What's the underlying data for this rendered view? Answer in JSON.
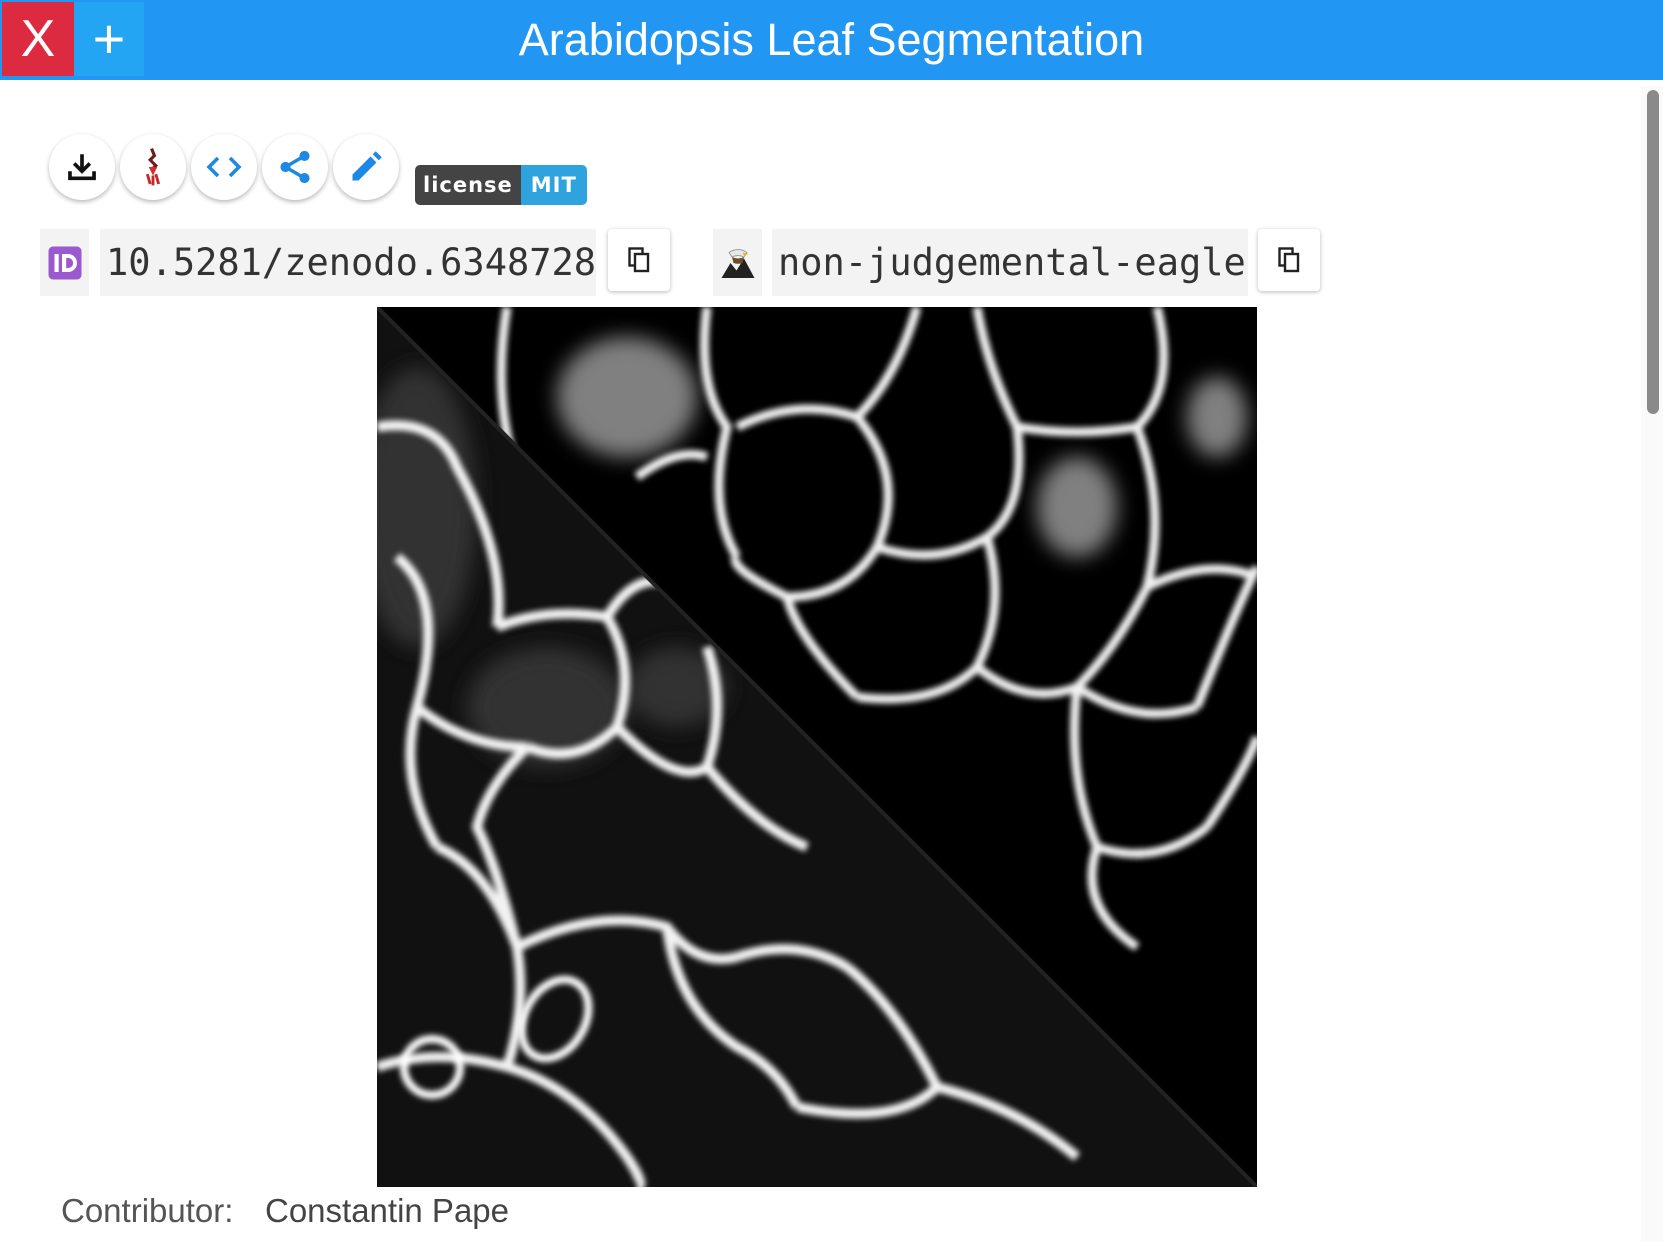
{
  "window": {
    "title": "Arabidopsis Leaf Segmentation",
    "close_label": "X",
    "add_label": "+"
  },
  "toolbar": {
    "buttons": [
      {
        "name": "download",
        "icon": "download-icon"
      },
      {
        "name": "ilastik",
        "icon": "ilastik-icon"
      },
      {
        "name": "code",
        "icon": "code-icon"
      },
      {
        "name": "share",
        "icon": "share-icon"
      },
      {
        "name": "edit",
        "icon": "edit-icon"
      }
    ]
  },
  "license": {
    "label": "license",
    "value": "MIT"
  },
  "identifiers": {
    "doi": "10.5281/zenodo.6348728",
    "nickname": "non-judgemental-eagle",
    "nickname_icon": "🦅"
  },
  "cover_image": {
    "description_icon": "cover-image"
  },
  "details": {
    "contributor_label": "Contributor:",
    "contributor_value": "Constantin Pape"
  },
  "colors": {
    "titlebar": "#2196f3",
    "close": "#dc2a40",
    "add": "#23a5f4",
    "accent": "#1e88e5",
    "id_badge": "#9b59d0"
  }
}
